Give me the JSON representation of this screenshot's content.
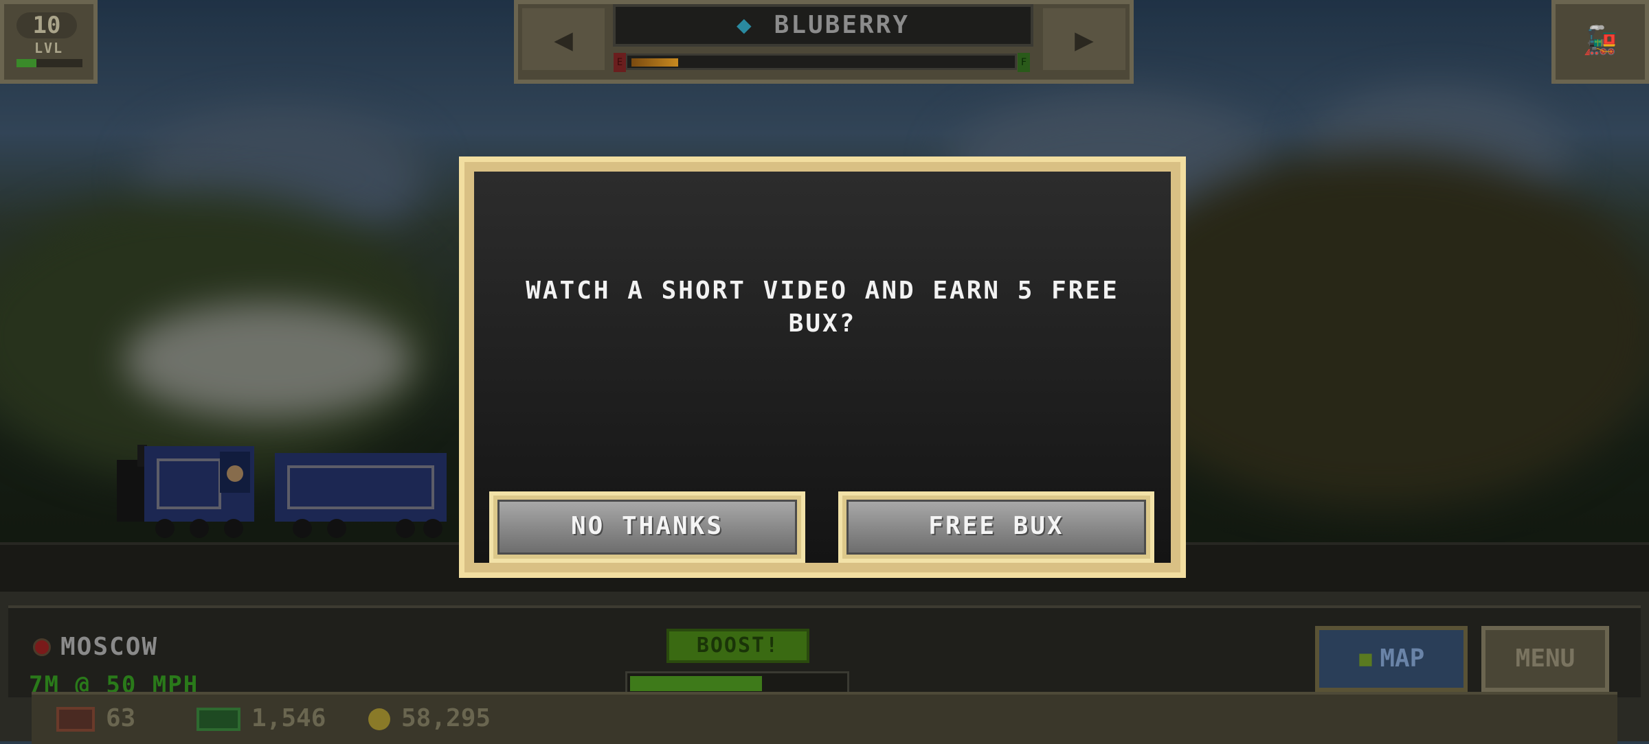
{
  "hud_top": {
    "level": "10",
    "level_label": "LVL",
    "level_progress": 0.3,
    "train_name": "BLUBERRY",
    "fuel_level": 0.12,
    "fuel_empty_label": "E",
    "fuel_full_label": "F",
    "prev_arrow": "◀",
    "next_arrow": "▶"
  },
  "dialog": {
    "message": "WATCH A SHORT VIDEO AND EARN 5 FREE BUX?",
    "no_thanks_label": "NO THANKS",
    "free_bux_label": "FREE BUX"
  },
  "hud_bottom": {
    "station": "MOSCOW",
    "speed_text": "7M @ 50 MPH",
    "boost_label": "BOOST!",
    "boost_progress": 0.6,
    "map_label": "MAP",
    "menu_label": "MENU"
  },
  "resources": {
    "cargo": "63",
    "bux": "1,546",
    "coins": "58,295"
  },
  "colors": {
    "dialog_border": "#f2dea0",
    "button_face": "#8a8a8a",
    "speed_text": "#2a7a1a",
    "boost": "#3a6a12"
  }
}
